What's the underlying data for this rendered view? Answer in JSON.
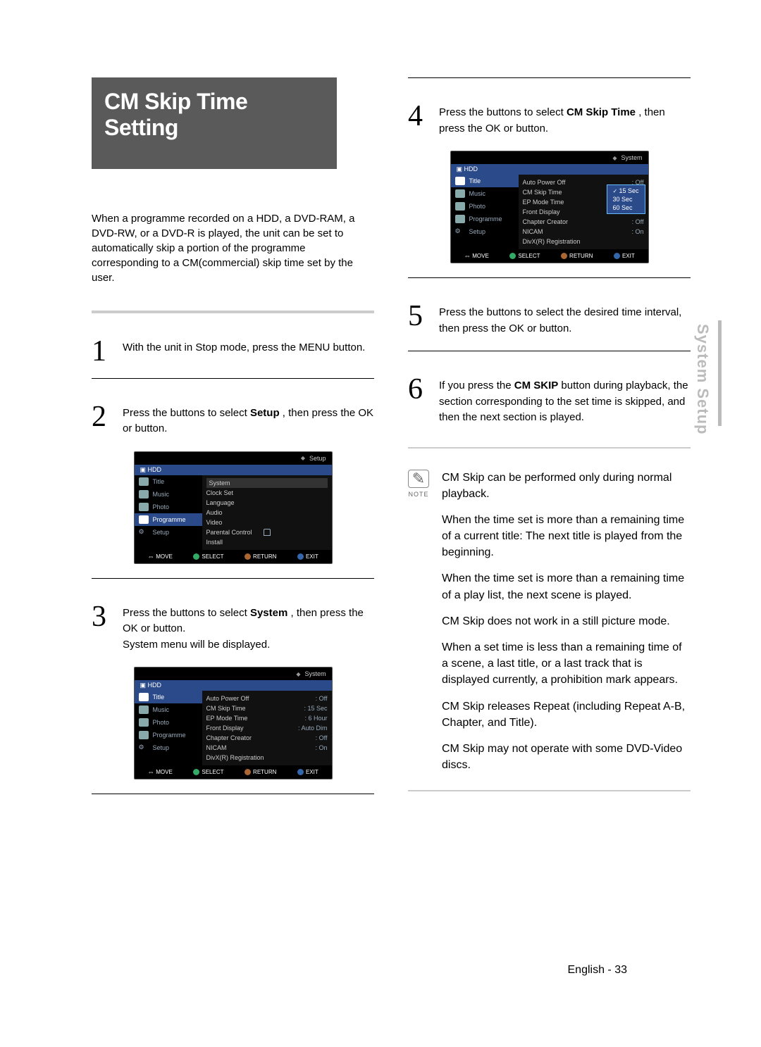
{
  "page_title": "CM Skip Time Setting",
  "intro": "When a programme recorded on a HDD, a DVD-RAM, a DVD-RW, or a DVD-R is played, the unit can be set to automatically skip a portion of the programme corresponding to a CM(commercial) skip time set by the user.",
  "steps": {
    "s1": "With the unit in Stop mode, press the MENU button.",
    "s2a": "Press the ",
    "s2b": " buttons to select ",
    "s2c": "Setup",
    "s2d": " , then press the OK or ",
    "s2e": " button.",
    "s3a": "Press the ",
    "s3b": " buttons to select ",
    "s3c": "System",
    "s3d": " , then press the OK or ",
    "s3e": " button.",
    "s3f": "System menu will be displayed.",
    "s4a": "Press the ",
    "s4b": " buttons to select ",
    "s4c": "CM Skip Time",
    "s4d": " , then press the OK or ",
    "s4e": " button.",
    "s5a": "Press the ",
    "s5b": " buttons to select the desired time interval, then press the OK or ",
    "s5c": " button.",
    "s6a": "If you press the ",
    "s6b": "CM SKIP",
    "s6c": " button during playback, the section corresponding to the set time is skipped, and then the next section is played."
  },
  "side_tab": "System Setup",
  "note_label": "NOTE",
  "notes": {
    "n1": "CM Skip can be performed only during normal playback.",
    "n2": "When the time set is more than a remaining time of a current title: The next title is played from the beginning.",
    "n3": "When the time set is more than a remaining time of a play list, the next scene is played.",
    "n4": "CM Skip does not work in a still picture mode.",
    "n5": "When a set time is less than a remaining time of a scene, a last title, or a last track that is displayed currently, a prohibition mark appears.",
    "n6": "CM Skip releases Repeat (including Repeat A-B, Chapter, and Title).",
    "n7": "CM Skip may not operate with some DVD-Video discs."
  },
  "osd": {
    "breadcrumb_setup": "Setup",
    "breadcrumb_system": "System",
    "hdd_label": "HDD",
    "nav": {
      "title": "Title",
      "music": "Music",
      "photo": "Photo",
      "programme": "Programme",
      "setup": "Setup"
    },
    "setup_menu": {
      "system": "System",
      "clock": "Clock Set",
      "language": "Language",
      "audio": "Audio",
      "video": "Video",
      "parental": "Parental Control",
      "install": "Install"
    },
    "system_menu": {
      "auto_power": {
        "label": "Auto Power Off",
        "val": ": Off"
      },
      "cm_skip": {
        "label": "CM Skip Time",
        "val": ": 15 Sec"
      },
      "ep_mode": {
        "label": "EP Mode Time",
        "val": ": 6 Hour"
      },
      "front": {
        "label": "Front Display",
        "val": ": Auto Dim"
      },
      "chapter": {
        "label": "Chapter Creator",
        "val": ": Off"
      },
      "nicam": {
        "label": "NICAM",
        "val": ": On"
      },
      "divx": {
        "label": "DivX(R) Registration",
        "val": ""
      }
    },
    "system_menu_popup": {
      "auto_power": {
        "label": "Auto Power Off",
        "val": ": Off"
      },
      "cm_skip": {
        "label": "CM Skip Time"
      },
      "ep_mode": {
        "label": "EP Mode Time"
      },
      "front": {
        "label": "Front Display"
      },
      "chapter": {
        "label": "Chapter Creator",
        "val": ": Off"
      },
      "nicam": {
        "label": "NICAM",
        "val": ": On"
      },
      "divx": {
        "label": "DivX(R) Registration",
        "val": ""
      }
    },
    "popup_options": {
      "o1": "15 Sec",
      "o2": "30 Sec",
      "o3": "60 Sec"
    },
    "footer": {
      "move": "MOVE",
      "select": "SELECT",
      "return": "RETURN",
      "exit": "EXIT"
    }
  },
  "footer_text": "English - 33"
}
